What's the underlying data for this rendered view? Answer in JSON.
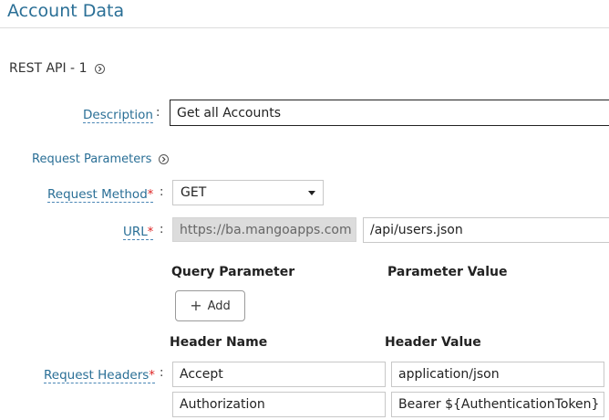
{
  "page": {
    "title": "Account Data"
  },
  "api": {
    "title": "REST API - 1",
    "description_label": "Description",
    "description_value": "Get all Accounts",
    "request_params_label": "Request Parameters",
    "method_label": "Request Method",
    "method_value": "GET",
    "url_label": "URL",
    "url_base": "https://ba.mangoapps.com",
    "url_path": "/api/users.json",
    "required_mark": "*",
    "colon": ":",
    "query_param_header": "Query Parameter",
    "param_value_header": "Parameter Value",
    "add_label": "Add",
    "header_name_header": "Header Name",
    "header_value_header": "Header Value",
    "headers_label": "Request Headers",
    "headers": [
      {
        "name": "Accept",
        "value": "application/json"
      },
      {
        "name": "Authorization",
        "value": "Bearer ${AuthenticationToken}"
      }
    ]
  },
  "icons": {
    "expand": "chevron-right-circle-icon",
    "add": "plus-icon",
    "dropdown": "caret-down-icon"
  },
  "colors": {
    "accent": "#2a6f96",
    "required": "#dd2222"
  }
}
